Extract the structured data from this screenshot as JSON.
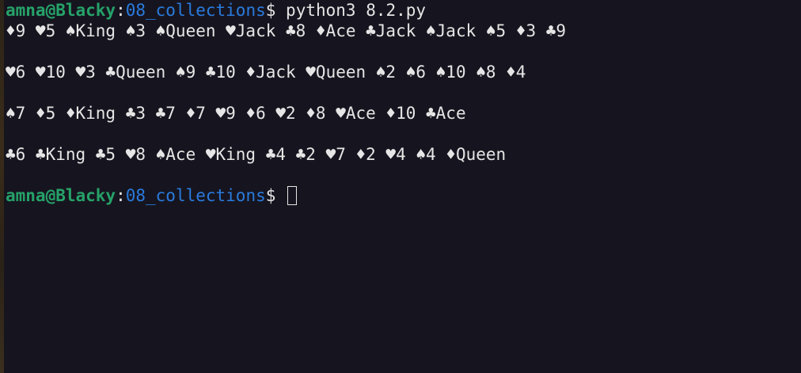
{
  "prompt": {
    "user_host": "amna@Blacky",
    "colon": ":",
    "path": "08_collections",
    "symbol": "$ "
  },
  "command": "python3 8.2.py",
  "output_lines": [
    "♦9 ♥5 ♠King ♠3 ♠Queen ♥Jack ♣8 ♦Ace ♣Jack ♠Jack ♠5 ♦3 ♣9",
    "",
    "♥6 ♥10 ♥3 ♣Queen ♠9 ♣10 ♦Jack ♥Queen ♠2 ♠6 ♠10 ♠8 ♦4",
    "",
    "♠7 ♦5 ♦King ♣3 ♣7 ♦7 ♥9 ♦6 ♥2 ♦8 ♥Ace ♦10 ♣Ace",
    "",
    "♣6 ♣King ♣5 ♥8 ♠Ace ♥King ♣4 ♣2 ♥7 ♦2 ♥4 ♠4 ♦Queen",
    ""
  ],
  "colors": {
    "background": "#16151f",
    "user_host": "#26a269",
    "path": "#2a7bde",
    "text": "#e6e6e6"
  }
}
